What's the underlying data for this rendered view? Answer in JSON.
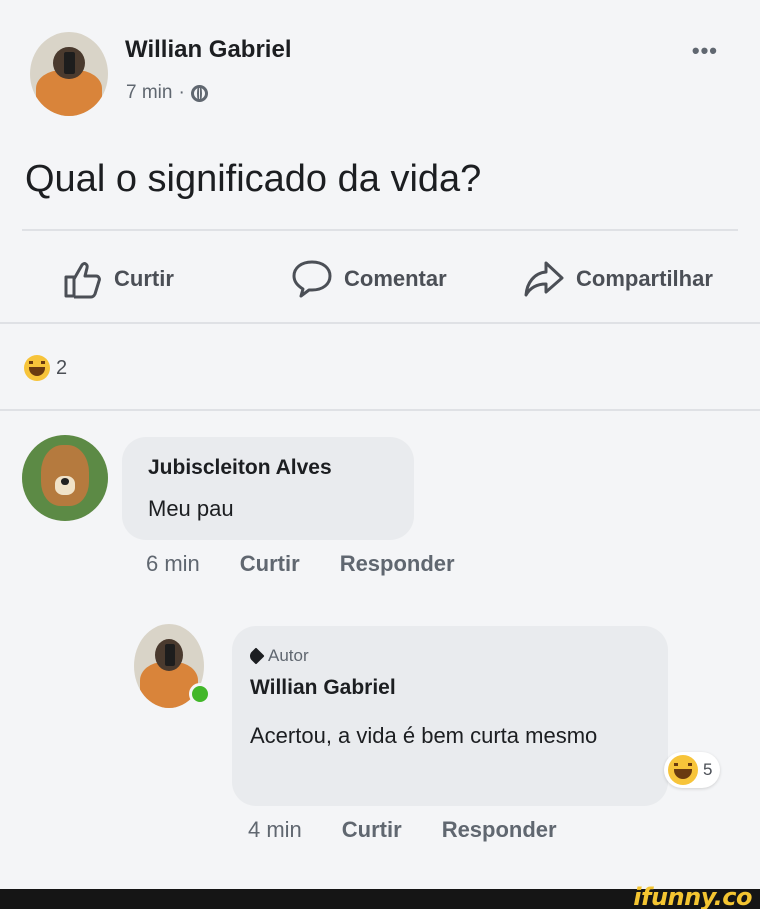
{
  "post": {
    "author": "Willian Gabriel",
    "time": "7 min",
    "separator": "·",
    "text": "Qual o significado da vida?",
    "more_label": "•••"
  },
  "actions": {
    "like": "Curtir",
    "comment": "Comentar",
    "share": "Compartilhar"
  },
  "reactions": {
    "count": "2"
  },
  "comments": [
    {
      "author": "Jubiscleiton Alves",
      "text": "Meu pau",
      "time": "6 min",
      "like": "Curtir",
      "reply": "Responder"
    }
  ],
  "reply": {
    "badge": "Autor",
    "author": "Willian Gabriel",
    "text": "Acertou, a vida é bem curta mesmo",
    "time": "4 min",
    "like": "Curtir",
    "reply": "Responder",
    "reaction_count": "5"
  },
  "watermark": "ifunny.co",
  "colors": {
    "accent_online": "#42b72a",
    "reaction": "#f7c43a",
    "watermark": "#f4c531"
  }
}
